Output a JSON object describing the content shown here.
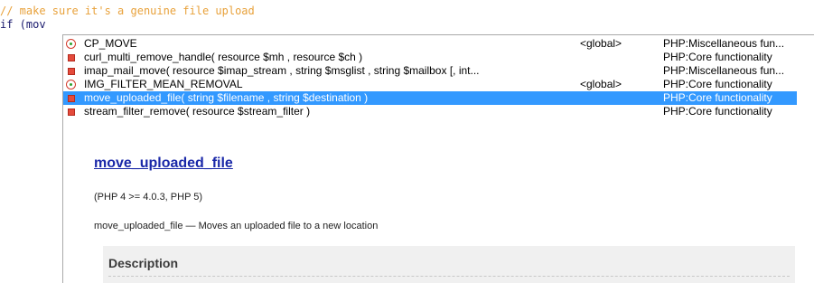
{
  "editor": {
    "comment_line": "// make sure it's a genuine file upload",
    "code_line": "if (mov"
  },
  "completion": {
    "items": [
      {
        "icon": "constant-icon",
        "name": "CP_MOVE",
        "scope": "<global>",
        "category": "PHP:Miscellaneous fun...",
        "selected": false
      },
      {
        "icon": "function-icon",
        "name": "curl_multi_remove_handle( resource $mh , resource $ch )",
        "scope": "",
        "category": "PHP:Core functionality",
        "selected": false
      },
      {
        "icon": "function-icon",
        "name": "imap_mail_move( resource $imap_stream , string $msglist , string $mailbox [, int...",
        "scope": "",
        "category": "PHP:Miscellaneous fun...",
        "selected": false
      },
      {
        "icon": "constant-icon",
        "name": "IMG_FILTER_MEAN_REMOVAL",
        "scope": "<global>",
        "category": "PHP:Core functionality",
        "selected": false
      },
      {
        "icon": "function-icon",
        "name": "move_uploaded_file( string $filename , string $destination )",
        "scope": "",
        "category": "PHP:Core functionality",
        "selected": true
      },
      {
        "icon": "function-icon",
        "name": "stream_filter_remove( resource $stream_filter )",
        "scope": "",
        "category": "PHP:Core functionality",
        "selected": false
      }
    ]
  },
  "doc": {
    "title": "move_uploaded_file",
    "version": "(PHP 4 >= 4.0.3, PHP 5)",
    "summary": "move_uploaded_file — Moves an uploaded file to a new location",
    "description_heading": "Description"
  },
  "colors": {
    "comment": "#e8a13a",
    "selection": "#3399ff",
    "doc_link": "#1a28a8"
  }
}
